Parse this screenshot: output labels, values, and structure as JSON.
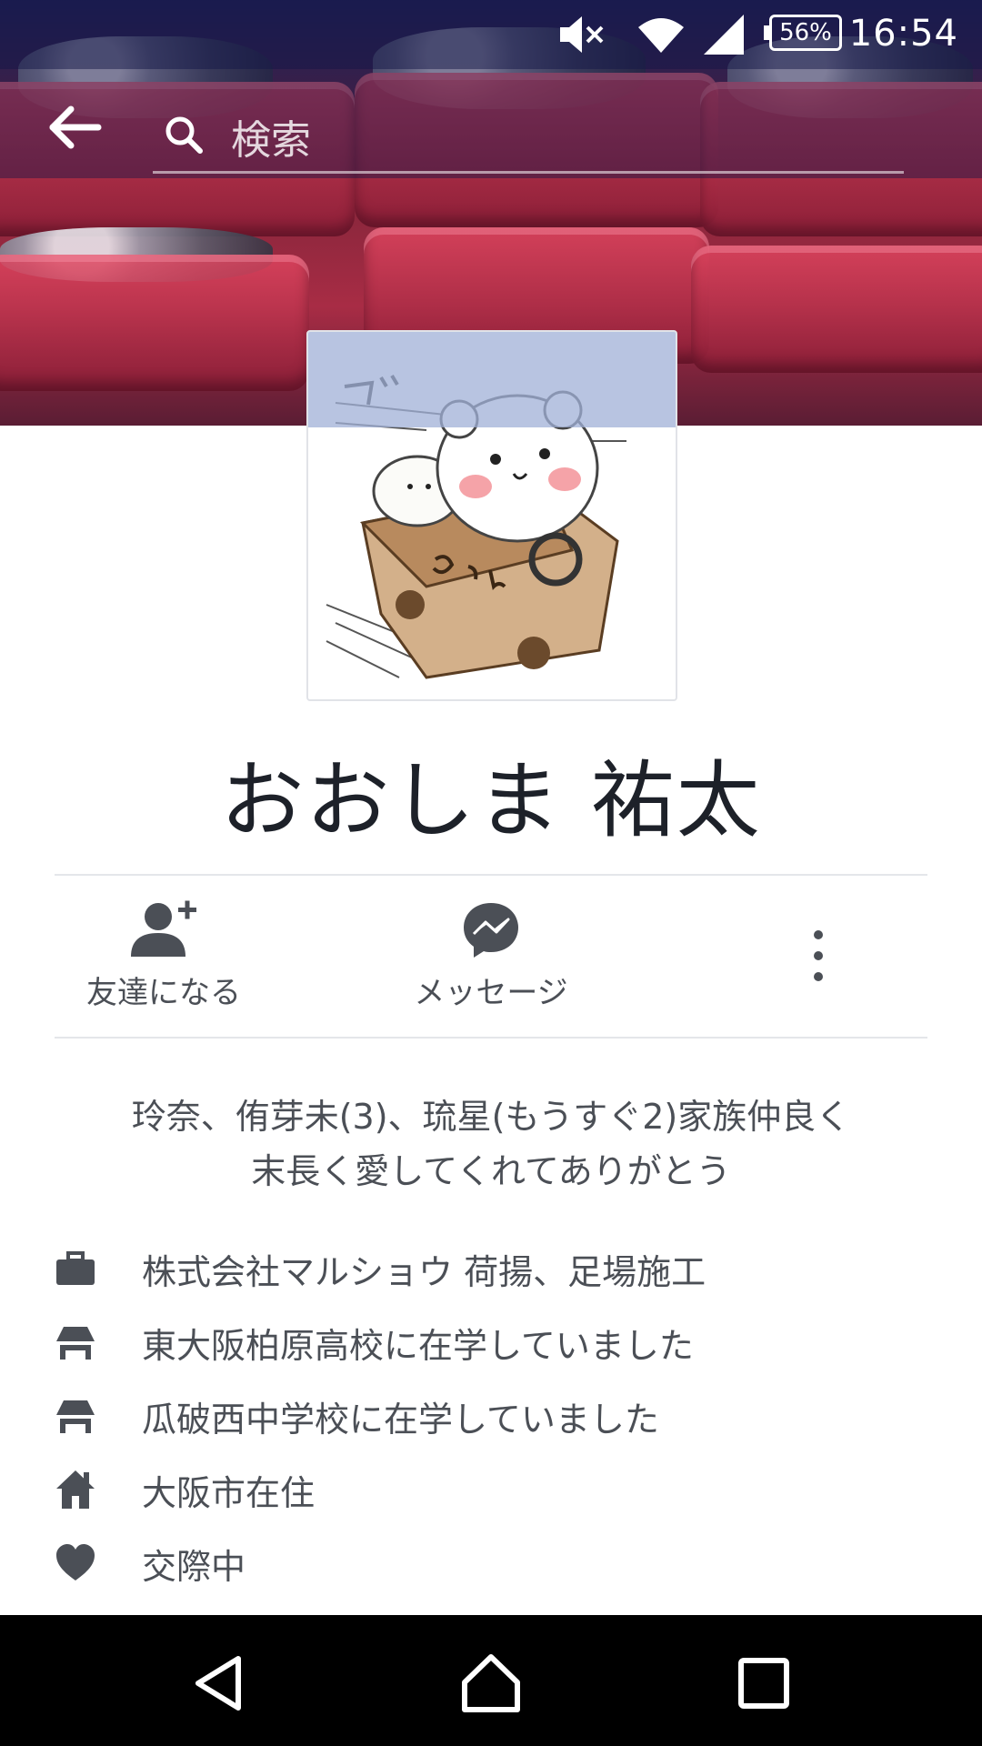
{
  "status_bar": {
    "battery": "56%",
    "time": "16:54"
  },
  "search": {
    "placeholder": "検索"
  },
  "profile": {
    "name": "おおしま 祐太"
  },
  "actions": {
    "add_friend": "友達になる",
    "message": "メッセージ"
  },
  "bio": {
    "line1": "玲奈、侑芽未(3)、琉星(もうすぐ2)家族仲良く",
    "line2": "末長く愛してくれてありがとう"
  },
  "info": {
    "work": "株式会社マルショウ 荷揚、足場施工",
    "high_school": "東大阪柏原高校に在学していました",
    "middle_school": "瓜破西中学校に在学していました",
    "residence": "大阪市在住",
    "relationship": "交際中"
  },
  "colors": {
    "icon_gray": "#4b4f56",
    "text": "#1d2129",
    "status_bar": "#14164a",
    "cover_red": "#a82c45"
  }
}
